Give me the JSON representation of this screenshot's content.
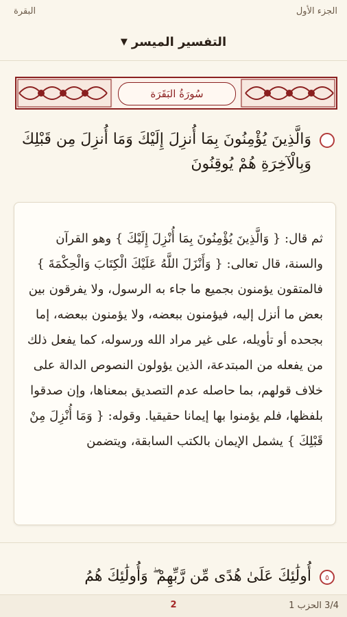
{
  "top_bar": {
    "juz": "الجزء الأول",
    "surah": "البقرة"
  },
  "header": {
    "tafsir_selector": "التفسير الميسر"
  },
  "banner": {
    "title": "سُورَةُ البَقَرَة"
  },
  "ayah_current": {
    "number": "",
    "text": "وَالَّذِينَ يُؤْمِنُونَ بِمَا أُنزِلَ إِلَيْكَ وَمَا أُنزِلَ مِن قَبْلِكَ وَبِالْآخِرَةِ هُمْ يُوقِنُونَ"
  },
  "tafsir": {
    "text": "ثم قال: { وَالَّذِينَ يُؤْمِنُونَ بِمَا أُنْزِلَ إِلَيْكَ } وهو القرآن والسنة، قال تعالى: { وَأَنْزَلَ اللَّهُ عَلَيْكَ الْكِتَابَ وَالْحِكْمَةَ } فالمتقون يؤمنون بجميع ما جاء به الرسول، ولا يفرقون بين بعض ما أنزل إليه، فيؤمنون ببعضه، ولا يؤمنون ببعضه، إما بجحده أو تأويله، على غير مراد الله ورسوله، كما يفعل ذلك من يفعله من المبتدعة، الذين يؤولون النصوص الدالة على خلاف قولهم، بما حاصله عدم التصديق بمعناها، وإن صدقوا بلفظها، فلم يؤمنوا بها إيمانا حقيقيا. وقوله: { وَمَا أُنْزِلَ مِنْ قَبْلِكَ } يشمل الإيمان بالكتب السابقة، ويتضمن"
  },
  "ayah_next": {
    "number": "٥",
    "text": "أُولَٰئِكَ عَلَىٰ هُدًى مِّن رَّبِّهِمْ ۖ وَأُولَٰئِكَ هُمُ"
  },
  "bottom_bar": {
    "position": "3/4 الحزب 1",
    "page": "2"
  },
  "colors": {
    "accent": "#8a1f1f",
    "background": "#faf6ec",
    "marker": "#b23a3a"
  }
}
